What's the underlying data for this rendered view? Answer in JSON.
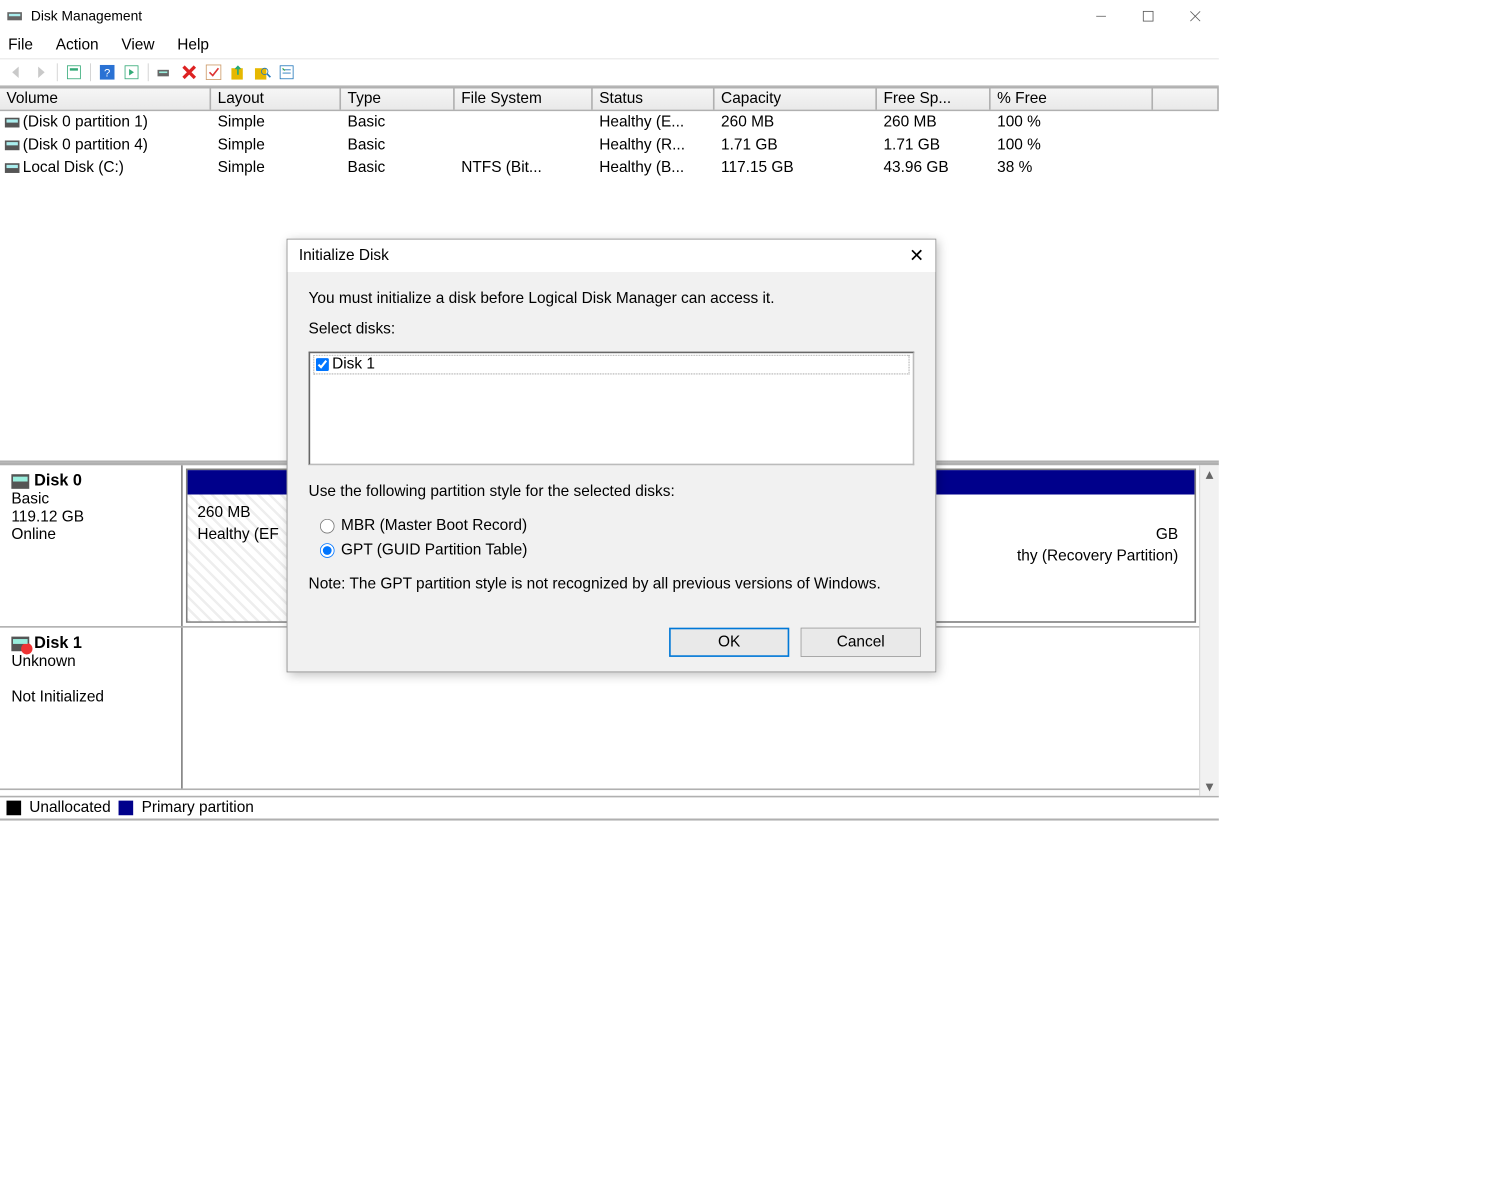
{
  "window": {
    "title": "Disk Management"
  },
  "menu": [
    "File",
    "Action",
    "View",
    "Help"
  ],
  "columns": {
    "c1": "Volume",
    "c2": "Layout",
    "c3": "Type",
    "c4": "File System",
    "c5": "Status",
    "c6": "Capacity",
    "c7": "Free Sp...",
    "c8": "% Free"
  },
  "volumes": [
    {
      "name": "(Disk 0 partition 1)",
      "layout": "Simple",
      "type": "Basic",
      "fs": "",
      "status": "Healthy (E...",
      "capacity": "260 MB",
      "free": "260 MB",
      "pct": "100 %"
    },
    {
      "name": "(Disk 0 partition 4)",
      "layout": "Simple",
      "type": "Basic",
      "fs": "",
      "status": "Healthy (R...",
      "capacity": "1.71 GB",
      "free": "1.71 GB",
      "pct": "100 %"
    },
    {
      "name": "Local Disk (C:)",
      "layout": "Simple",
      "type": "Basic",
      "fs": "NTFS (Bit...",
      "status": "Healthy (B...",
      "capacity": "117.15 GB",
      "free": "43.96 GB",
      "pct": "38 %"
    }
  ],
  "disk0": {
    "title": "Disk 0",
    "type": "Basic",
    "size": "119.12 GB",
    "status": "Online",
    "p1_line1": "260 MB",
    "p1_line2": "Healthy (EF",
    "p2_line1": "GB",
    "p2_line2": "thy (Recovery Partition)"
  },
  "disk1": {
    "title": "Disk 1",
    "type": "Unknown",
    "status": "Not Initialized"
  },
  "legend": {
    "a": "Unallocated",
    "b": "Primary partition"
  },
  "dialog": {
    "title": "Initialize Disk",
    "msg1": "You must initialize a disk before Logical Disk Manager can access it.",
    "sel_label": "Select disks:",
    "disk_item": "Disk 1",
    "style_label": "Use the following partition style for the selected disks:",
    "opt_mbr": "MBR (Master Boot Record)",
    "opt_gpt": "GPT (GUID Partition Table)",
    "note": "Note: The GPT partition style is not recognized by all previous versions of Windows.",
    "ok": "OK",
    "cancel": "Cancel"
  }
}
